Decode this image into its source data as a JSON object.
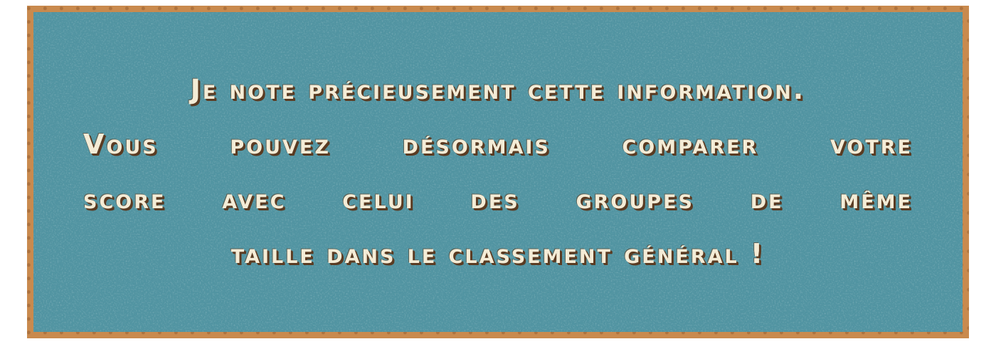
{
  "message": {
    "lines": [
      "Je note précieusement cette information.",
      "Vous pouvez désormais comparer votre",
      "score avec celui des groupes de même",
      "taille dans le classement général !"
    ]
  },
  "colors": {
    "board": "#4f93a1",
    "frame": "#c98a4e",
    "text": "#f4ecd6",
    "text_shadow": "#5a3b22"
  }
}
